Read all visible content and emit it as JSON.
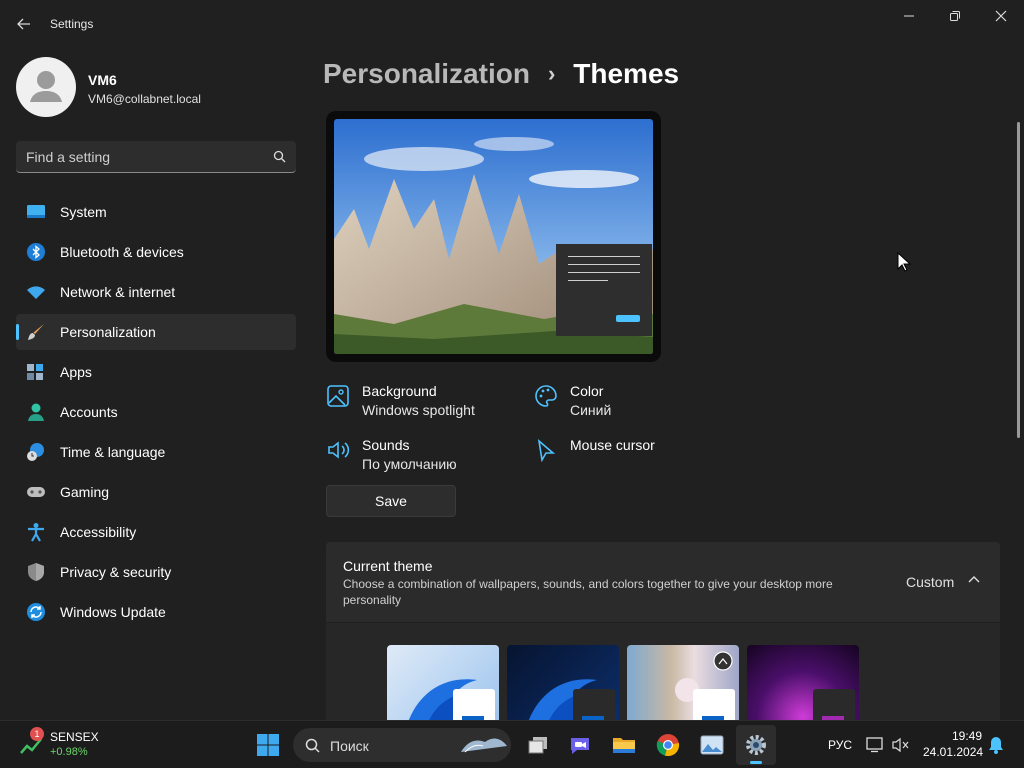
{
  "window": {
    "title": "Settings"
  },
  "profile": {
    "name": "VM6",
    "email": "VM6@collabnet.local"
  },
  "search": {
    "placeholder": "Find a setting"
  },
  "nav": {
    "items": [
      {
        "label": "System",
        "icon": "system-icon"
      },
      {
        "label": "Bluetooth & devices",
        "icon": "bluetooth-icon"
      },
      {
        "label": "Network & internet",
        "icon": "wifi-icon"
      },
      {
        "label": "Personalization",
        "icon": "brush-icon",
        "active": true
      },
      {
        "label": "Apps",
        "icon": "apps-icon"
      },
      {
        "label": "Accounts",
        "icon": "accounts-icon"
      },
      {
        "label": "Time & language",
        "icon": "globe-clock-icon"
      },
      {
        "label": "Gaming",
        "icon": "gamepad-icon"
      },
      {
        "label": "Accessibility",
        "icon": "accessibility-icon"
      },
      {
        "label": "Privacy & security",
        "icon": "shield-icon"
      },
      {
        "label": "Windows Update",
        "icon": "update-icon"
      }
    ]
  },
  "breadcrumb": {
    "parent": "Personalization",
    "separator": "›",
    "current": "Themes"
  },
  "theme_props": {
    "background": {
      "title": "Background",
      "value": "Windows spotlight"
    },
    "color": {
      "title": "Color",
      "value": "Синий"
    },
    "sounds": {
      "title": "Sounds",
      "value": "По умолчанию"
    },
    "cursor": {
      "title": "Mouse cursor"
    }
  },
  "save_label": "Save",
  "current_theme": {
    "title": "Current theme",
    "description": "Choose a combination of wallpapers, sounds, and colors together to give your desktop more personality",
    "value": "Custom"
  },
  "taskbar": {
    "widget": {
      "badge": "1",
      "name": "SENSEX",
      "change": "+0.98%"
    },
    "search_placeholder": "Поиск",
    "language": "РУС",
    "time": "19:49",
    "date": "24.01.2024"
  },
  "colors": {
    "accent": "#4cc2ff",
    "background": "#202020",
    "card": "#2b2b2b"
  }
}
